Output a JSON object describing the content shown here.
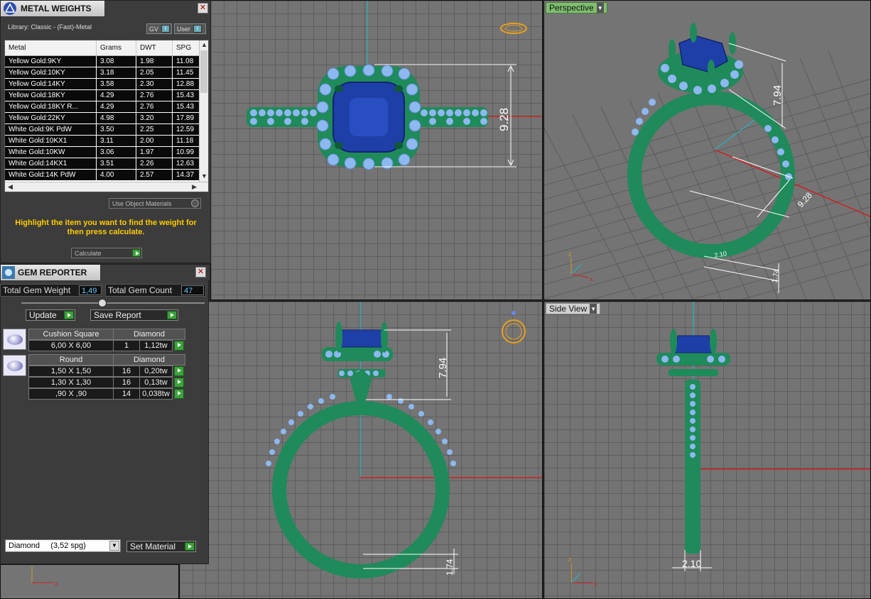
{
  "viewports": {
    "perspective_label": "Perspective",
    "side_label": "Side View"
  },
  "dimensions": {
    "top_height": "9.28",
    "persp_a": "7.94",
    "persp_b": "9.28",
    "persp_c": "1.74",
    "persp_d": "2.10",
    "front_height": "7.94",
    "front_band": "1.74",
    "side_width": "2.10"
  },
  "metal_panel": {
    "title": "METAL WEIGHTS",
    "library": "Library: Classic - (Fast)-Metal",
    "gv_label": "GV",
    "user_label": "User",
    "columns": [
      "Metal",
      "Grams",
      "DWT",
      "SPG"
    ],
    "rows": [
      [
        "Yellow Gold:9KY",
        "3.08",
        "1.98",
        "11.08"
      ],
      [
        "Yellow Gold:10KY",
        "3.18",
        "2.05",
        "11.45"
      ],
      [
        "Yellow Gold:14KY",
        "3.58",
        "2.30",
        "12.88"
      ],
      [
        "Yellow Gold:18KY",
        "4.29",
        "2.76",
        "15.43"
      ],
      [
        "Yellow Gold:18KY R...",
        "4.29",
        "2.76",
        "15.43"
      ],
      [
        "Yellow Gold:22KY",
        "4.98",
        "3.20",
        "17.89"
      ],
      [
        "White Gold:9K PdW",
        "3.50",
        "2.25",
        "12.59"
      ],
      [
        "White Gold:10KX1",
        "3.11",
        "2.00",
        "11.18"
      ],
      [
        "White Gold:10KW",
        "3.06",
        "1.97",
        "10.99"
      ],
      [
        "White Gold:14KX1",
        "3.51",
        "2.26",
        "12.63"
      ],
      [
        "White Gold:14K PdW",
        "4.00",
        "2.57",
        "14.37"
      ]
    ],
    "use_object_materials": "Use Object Materials",
    "hint": "Highlight the item you want to find the weight for then press calculate.",
    "calculate_label": "Calculate"
  },
  "gem_panel": {
    "title": "GEM REPORTER",
    "total_weight_label": "Total Gem Weight",
    "total_weight_value": "1,49",
    "total_count_label": "Total Gem Count",
    "total_count_value": "47",
    "update_label": "Update",
    "save_report_label": "Save Report",
    "groups": [
      {
        "shape": "Cushion Square",
        "material": "Diamond",
        "rows": [
          [
            "6,00 X 6,00",
            "1",
            "1,12tw"
          ]
        ]
      },
      {
        "shape": "Round",
        "material": "Diamond",
        "rows": [
          [
            "1,50 X 1,50",
            "16",
            "0,20tw"
          ],
          [
            "1,30 X 1,30",
            "16",
            "0,13tw"
          ],
          [
            ",90 X ,90",
            "14",
            "0,038tw"
          ]
        ]
      }
    ],
    "material_select": "Diamond     (3,52 spg)",
    "set_material_label": "Set Material"
  },
  "colors": {
    "metal": "#1f8a5a",
    "gem": "#1f3fa8",
    "melee": "#8db8f0",
    "dim": "#ffffff",
    "hint": "#ffcc00"
  }
}
